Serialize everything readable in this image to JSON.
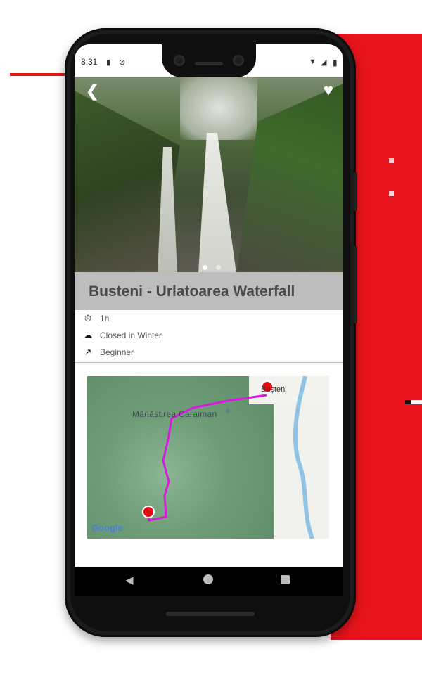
{
  "status_bar": {
    "time": "8:31",
    "icons": [
      "sd-card-icon",
      "do-not-disturb-icon",
      "wifi-icon",
      "signal-icon",
      "battery-icon"
    ]
  },
  "hero": {
    "image_dots": 2,
    "active_dot_index": 0
  },
  "trail": {
    "title": "Busteni - Urlatoarea Waterfall",
    "details": [
      {
        "icon": "timer-icon",
        "label": "1h"
      },
      {
        "icon": "cloud-icon",
        "label": "Closed in Winter"
      },
      {
        "icon": "trending-up-icon",
        "label": "Beginner"
      }
    ]
  },
  "map": {
    "poi_label": "Mănăstirea Caraiman",
    "town_label": "Bușteni",
    "watermark": "Google",
    "route_color": "#d81bdc",
    "marker_color": "#e50914"
  },
  "colors": {
    "accent_red": "#e8141b",
    "title_bar": "#bdbdbd"
  }
}
